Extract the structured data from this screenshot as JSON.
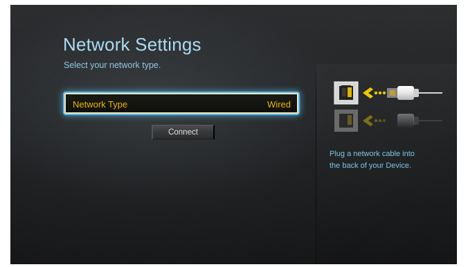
{
  "header": {
    "title": "Network Settings",
    "subtitle": "Select your network type."
  },
  "network_type": {
    "label": "Network Type",
    "value": "Wired"
  },
  "connect_button": {
    "label": "Connect"
  },
  "help_panel": {
    "line1": "Plug a network cable into",
    "line2": "the back of your Device.",
    "illustration": "ethernet-cable-icon"
  },
  "colors": {
    "title": "#a9dcf4",
    "highlight_text": "#efb800",
    "focus_glow": "#57b9e6",
    "help_text": "#7fc4e6",
    "arrow": "#f0c800"
  }
}
